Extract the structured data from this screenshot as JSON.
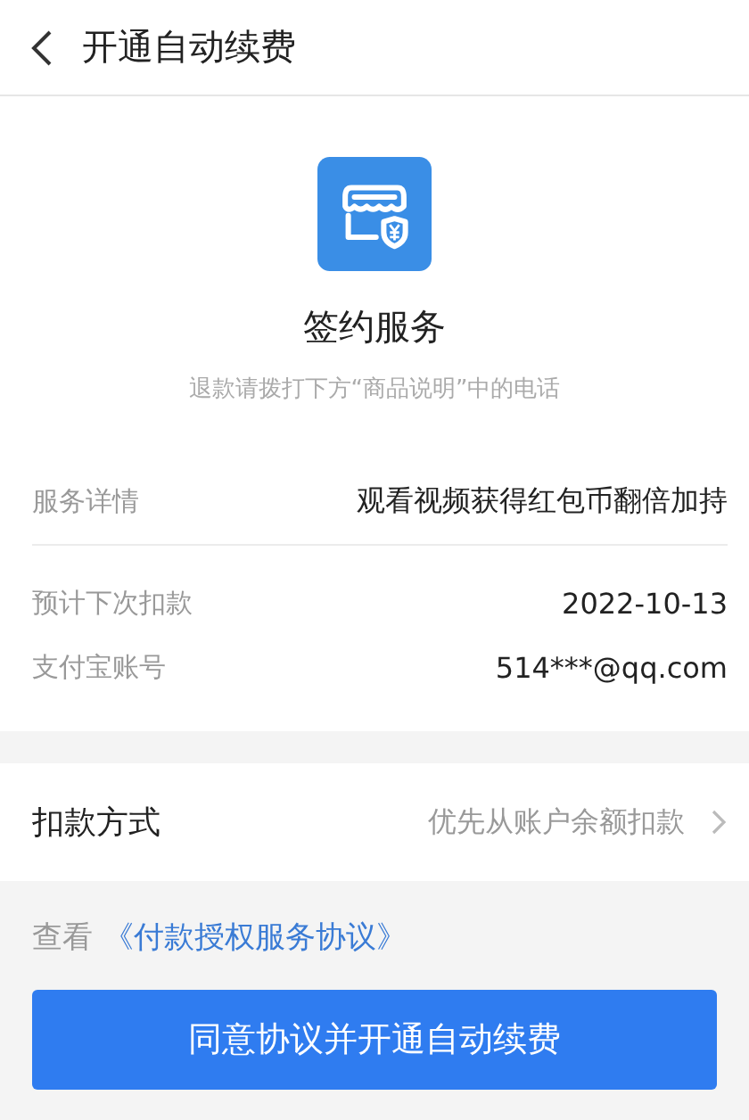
{
  "header": {
    "title": "开通自动续费"
  },
  "service": {
    "title": "签约服务",
    "subtitle": "退款请拨打下方“商品说明”中的电话"
  },
  "detail_groups": [
    {
      "rows": [
        {
          "label": "服务详情",
          "value": "观看视频获得红包币翻倍加持"
        }
      ]
    },
    {
      "rows": [
        {
          "label": "预计下次扣款",
          "value": "2022-10-13"
        },
        {
          "label": "支付宝账号",
          "value": "514***@qq.com"
        }
      ]
    }
  ],
  "payment_method": {
    "label": "扣款方式",
    "value": "优先从账户余额扣款"
  },
  "agreement": {
    "prefix": "查看",
    "link": "《付款授权服务协议》"
  },
  "confirm_button": "同意协议并开通自动续费"
}
